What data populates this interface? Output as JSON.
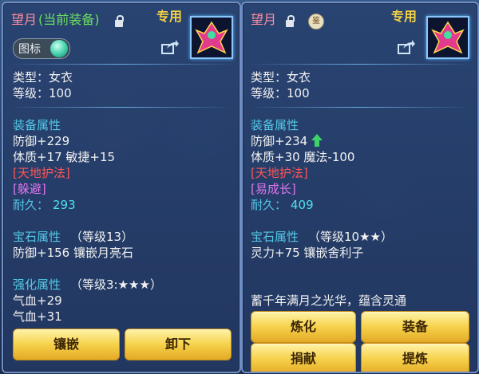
{
  "left": {
    "name": "望月",
    "equip_tag": "(当前装备)",
    "exclusive": "专用",
    "icon_label": "图标",
    "type": "类型：女衣",
    "level": "等级：100",
    "equip_attr_title": "装备属性",
    "defense": "防御+229",
    "stats": "体质+17 敏捷+15",
    "skill1": "[天地护法]",
    "skill2": "[躲避]",
    "durability_label": "耐久：",
    "durability_value": "293",
    "gem_title": "宝石属性",
    "gem_level": "（等级13）",
    "gem_effect": "防御+156 镶嵌月亮石",
    "enhance_title": "强化属性",
    "enhance_level": "（等级3:★★★）",
    "hp1": "气血+29",
    "hp2": "气血+31",
    "buttons": [
      "镶嵌",
      "卸下"
    ]
  },
  "right": {
    "name": "望月",
    "seal_char": "鉴",
    "exclusive": "专用",
    "type": "类型：女衣",
    "level": "等级：100",
    "equip_attr_title": "装备属性",
    "defense": "防御+234",
    "stats": "体质+30 魔法-100",
    "skill1": "[天地护法]",
    "skill2": "[易成长]",
    "durability_label": "耐久：",
    "durability_value": "409",
    "gem_title": "宝石属性",
    "gem_level": "（等级10★★）",
    "gem_effect": "灵力+75 镶嵌舍利子",
    "description": "蓄千年满月之光华，蕴含灵通",
    "buttons": [
      "炼化",
      "装备",
      "捐献",
      "提炼"
    ]
  },
  "colors": {
    "name": "#ff8fa3",
    "equipped": "#6be05d",
    "section": "#53c9e6",
    "exclusive": "#f6d341",
    "up_arrow": "#3ed36a"
  }
}
